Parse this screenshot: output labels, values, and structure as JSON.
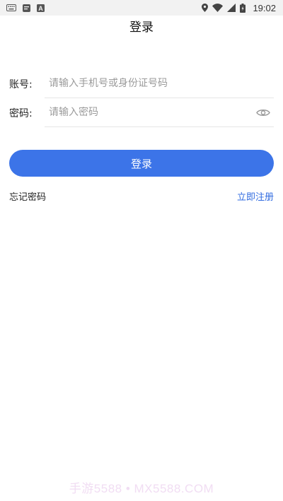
{
  "status_bar": {
    "time": "19:02",
    "left_icons": [
      "keyboard-icon",
      "message-icon",
      "a-letter-icon"
    ],
    "right_icons": [
      "location-pin-icon",
      "wifi-icon",
      "cell-signal-icon",
      "battery-icon"
    ],
    "notification_letter": "A"
  },
  "header": {
    "title": "登录"
  },
  "form": {
    "account": {
      "label": "账号:",
      "placeholder": "请输入手机号或身份证号码",
      "value": ""
    },
    "password": {
      "label": "密码:",
      "placeholder": "请输入密码",
      "value": "",
      "toggle_icon": "eye-icon"
    },
    "login_button_label": "登录"
  },
  "links": {
    "forgot_password": "忘记密码",
    "register": "立即注册"
  },
  "watermark": {
    "text": "手游5588 • MX5588.COM"
  },
  "colors": {
    "primary": "#3c74e8",
    "link": "#2f6ae0",
    "status_bar_bg": "#f2f2f2",
    "divider": "#e6e6e6",
    "watermark": "#f1ddf3"
  }
}
